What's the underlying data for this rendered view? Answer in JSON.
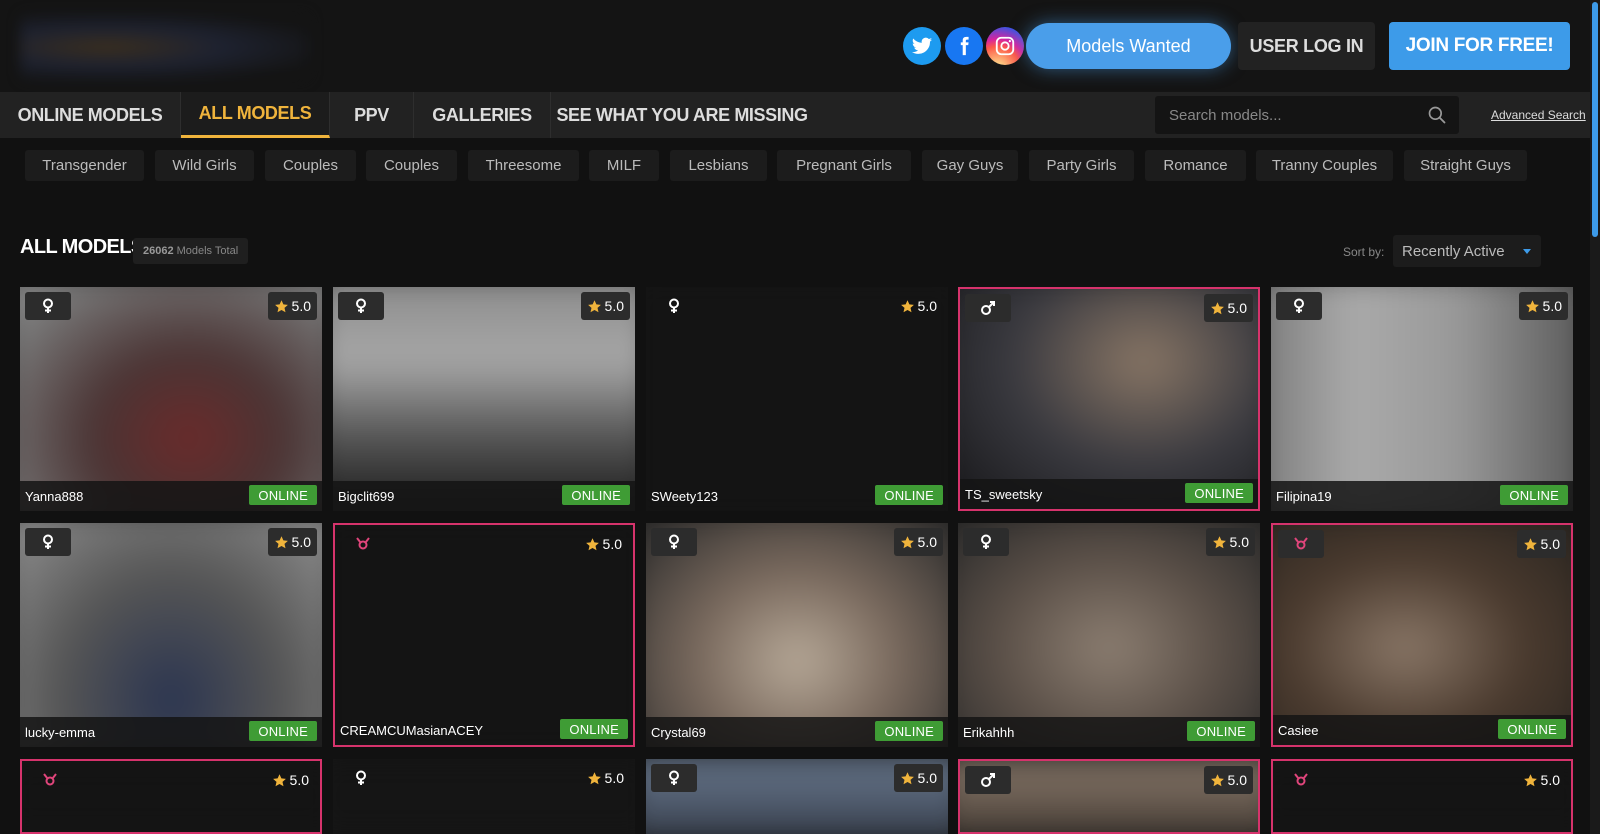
{
  "header": {
    "models_wanted": "Models Wanted",
    "login": "USER LOG IN",
    "join": "JOIN FOR FREE!"
  },
  "nav": {
    "items": [
      "ONLINE MODELS",
      "ALL MODELS",
      "PPV",
      "GALLERIES",
      "SEE WHAT YOU ARE MISSING"
    ],
    "active": "ALL MODELS",
    "search_placeholder": "Search models...",
    "advanced_search": "Advanced Search"
  },
  "tags": [
    "Transgender",
    "Wild Girls",
    "Couples",
    "Couples",
    "Threesome",
    "MILF",
    "Lesbians",
    "Pregnant Girls",
    "Gay Guys",
    "Party Girls",
    "Romance",
    "Tranny Couples",
    "Straight Guys"
  ],
  "section": {
    "title": "ALL MODELS",
    "total_count": "26062",
    "total_label": "Models Total",
    "sort_label": "Sort by:",
    "sort_value": "Recently Active"
  },
  "accent_colors": {
    "active_nav": "#f0b43c",
    "join": "#3d9be9",
    "online": "#3f9c35",
    "highlight_border": "#d6336c"
  },
  "models": [
    {
      "name": "Yanna888",
      "rating": "5.0",
      "status": "ONLINE",
      "gender": "female-icon",
      "highlight": false
    },
    {
      "name": "Bigclit699",
      "rating": "5.0",
      "status": "ONLINE",
      "gender": "female-icon",
      "highlight": false
    },
    {
      "name": "SWeety123",
      "rating": "5.0",
      "status": "ONLINE",
      "gender": "female-icon",
      "highlight": false
    },
    {
      "name": "TS_sweetsky",
      "rating": "5.0",
      "status": "ONLINE",
      "gender": "male-icon",
      "highlight": true
    },
    {
      "name": "Filipina19",
      "rating": "5.0",
      "status": "ONLINE",
      "gender": "female-icon",
      "highlight": false
    },
    {
      "name": "lucky-emma",
      "rating": "5.0",
      "status": "ONLINE",
      "gender": "female-icon",
      "highlight": false
    },
    {
      "name": "CREAMCUMasianACEY",
      "rating": "5.0",
      "status": "ONLINE",
      "gender": "transgender-icon",
      "highlight": true
    },
    {
      "name": "Crystal69",
      "rating": "5.0",
      "status": "ONLINE",
      "gender": "female-icon",
      "highlight": false
    },
    {
      "name": "Erikahhh",
      "rating": "5.0",
      "status": "ONLINE",
      "gender": "female-icon",
      "highlight": false
    },
    {
      "name": "Casiee",
      "rating": "5.0",
      "status": "ONLINE",
      "gender": "transgender-icon",
      "highlight": true
    },
    {
      "name": "",
      "rating": "5.0",
      "status": "",
      "gender": "transgender-icon",
      "highlight": true
    },
    {
      "name": "",
      "rating": "5.0",
      "status": "",
      "gender": "female-icon",
      "highlight": false
    },
    {
      "name": "",
      "rating": "5.0",
      "status": "",
      "gender": "female-icon",
      "highlight": false
    },
    {
      "name": "",
      "rating": "5.0",
      "status": "",
      "gender": "male-icon",
      "highlight": true
    },
    {
      "name": "",
      "rating": "5.0",
      "status": "",
      "gender": "transgender-icon",
      "highlight": true
    }
  ]
}
